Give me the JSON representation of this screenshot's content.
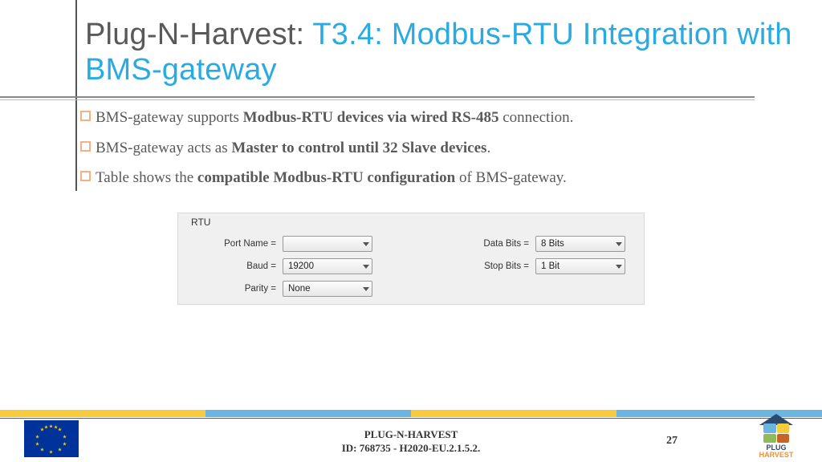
{
  "title": {
    "prefix": "Plug-N-Harvest: ",
    "suffix": "T3.4: Modbus-RTU Integration with BMS-gateway"
  },
  "bullets": [
    {
      "pre": "BMS-gateway supports ",
      "bold": "Modbus-RTU devices via wired RS-485",
      "post": " connection."
    },
    {
      "pre": "BMS-gateway acts as ",
      "bold": "Master to control until 32 Slave devices",
      "post": "."
    },
    {
      "pre": " Table shows the ",
      "bold": "compatible Modbus-RTU configuration",
      "post": " of BMS-gateway."
    }
  ],
  "rtu": {
    "title": "RTU",
    "fields": {
      "port_name": {
        "label": "Port Name =",
        "value": ""
      },
      "baud": {
        "label": "Baud =",
        "value": "19200"
      },
      "parity": {
        "label": "Parity =",
        "value": "None"
      },
      "data_bits": {
        "label": "Data Bits =",
        "value": "8 Bits"
      },
      "stop_bits": {
        "label": "Stop Bits =",
        "value": "1 Bit"
      }
    }
  },
  "footer": {
    "line1": "PLUG-N-HARVEST",
    "line2": "ID: 768735 - H2020-EU.2.1.5.2."
  },
  "page_number": "27",
  "logo": {
    "top": "PLUG",
    "bottom": "HARVEST"
  }
}
